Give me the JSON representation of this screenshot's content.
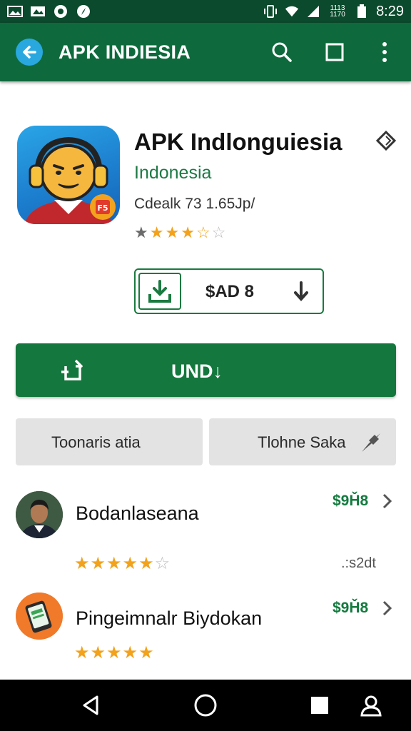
{
  "status_bar": {
    "signal_text": "1113\n1170",
    "time": "8:29",
    "icons": [
      "gallery-icon",
      "photos-icon",
      "record-icon",
      "compass-icon",
      "vibrate-icon",
      "wifi-icon",
      "signal-icon",
      "battery-icon"
    ]
  },
  "app_bar": {
    "title": "APK INDIESIA",
    "color": "#0e6a3c",
    "icons": [
      "back-arrow-icon",
      "search-icon",
      "square-icon",
      "more-vert-icon"
    ]
  },
  "app": {
    "name": "APK Indlonguiesia",
    "developer": "Indonesia",
    "meta": "Cdealk 73 1.65Jp/",
    "rating_stars": [
      "grey",
      "filled",
      "filled",
      "filled",
      "half",
      "empty"
    ],
    "price_label": "$AD 8"
  },
  "install": {
    "label": "UND↓",
    "color": "#14773d"
  },
  "secondary_buttons": {
    "left_label": "Toonaris atia",
    "right_label": "Tlohne Saka"
  },
  "list": [
    {
      "title": "Bodanlaseana",
      "price": "$9Ȟ8",
      "stars": "★★★★★",
      "extra": ".:s2dt"
    },
    {
      "title": "Pingeimnalr Biydokan",
      "price": "$9Ȟ8",
      "stars": "★★★★★",
      "extra": ""
    }
  ],
  "nav_bar": {
    "icons": [
      "back-triangle-icon",
      "home-circle-icon",
      "recents-square-icon",
      "person-icon"
    ]
  }
}
